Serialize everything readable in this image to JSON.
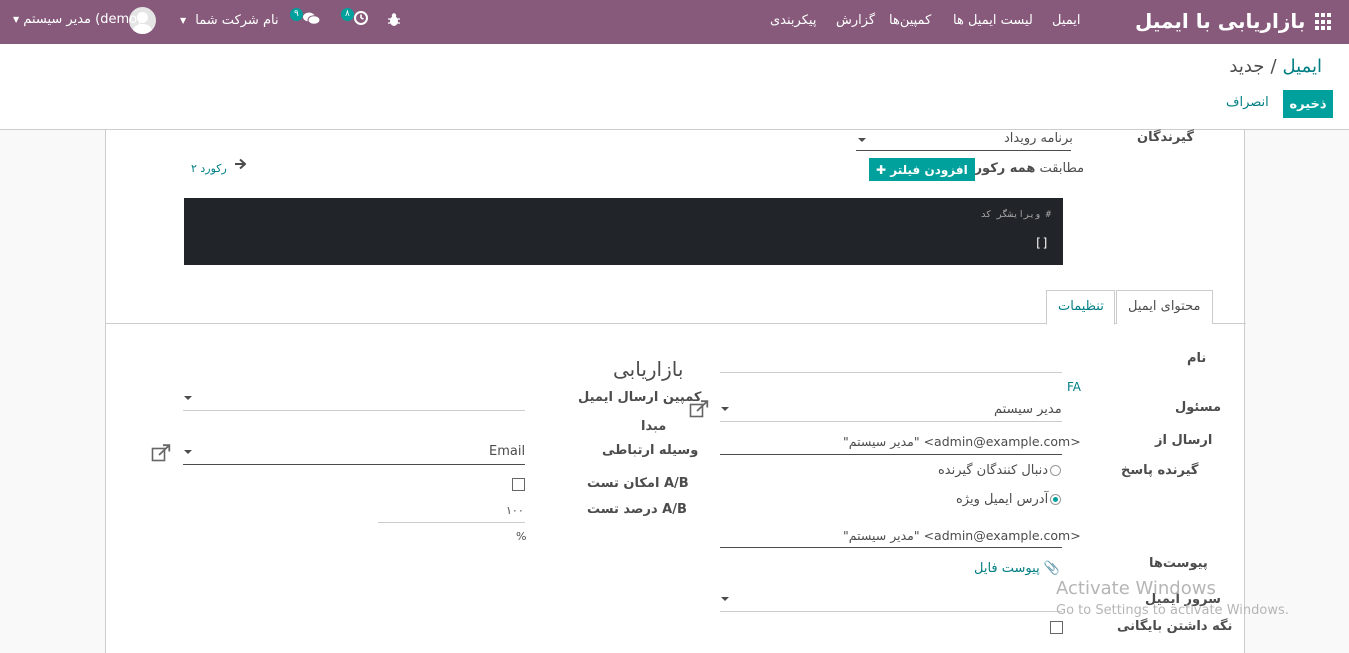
{
  "navbar": {
    "app_title": "بازاریابی با ایمیل",
    "menu": [
      "ایمیل",
      "لیست ایمیل ها",
      "کمپین‌ها",
      "گزارش",
      "پیکربندی"
    ],
    "activity_count": "۸",
    "messages_count": "۹",
    "company": "نام شرکت شما",
    "user": "مدیر سیستم (demo)"
  },
  "breadcrumb": {
    "parent": "ایمیل",
    "separator": "/",
    "current": "جدید"
  },
  "buttons": {
    "save": "ذخیره",
    "discard": "انصراف"
  },
  "form": {
    "recipients_label": "گیرندگان",
    "recipients_value": "برنامه رویداد",
    "match_prefix": "مطابقت",
    "match_all": "همه رکوردها",
    "add_filter": "افزودن فیلتر",
    "record_count": "۲ رکورد",
    "code_comment": "# ویرایشگر کد",
    "code_value": "[]",
    "tabs": {
      "content": "محتوای ایمیل",
      "settings": "تنظیمات"
    },
    "name_label": "نام",
    "lang_badge": "FA",
    "responsible_label": "مسئول",
    "responsible_value": "مدیر سیستم",
    "send_from_label": "ارسال از",
    "send_from_value": "\"مدیر سیستم\" <admin@example.com>",
    "reply_to_label": "گیرنده پاسخ",
    "reply_option_followers": "دنبال کنندگان گیرنده",
    "reply_option_specific": "آدرس ایمیل ویژه",
    "reply_to_value": "\"مدیر سیستم\" <admin@example.com>",
    "attachments_label": "پیوست‌ها",
    "attach_file": "پیوست فایل",
    "mail_server_label": "سرور ایمیل",
    "keep_archive_label": "نگه داشتن بایگانی",
    "section_marketing": "بازاریابی",
    "campaign_label": "کمپین ارسال ایمیل",
    "source_label": "مبدا",
    "medium_label": "وسیله ارتباطی",
    "medium_value": "Email",
    "ab_test_label": "امکان تست A/B",
    "ab_percent_label": "درصد تست A/B",
    "ab_percent_value": "۱۰۰",
    "percent_sign": "%"
  },
  "watermark": {
    "title": "Activate Windows",
    "subtitle": "Go to Settings to activate Windows."
  },
  "colors": {
    "navbar": "#875a7b",
    "primary": "#00a09d",
    "link": "#017e84"
  }
}
